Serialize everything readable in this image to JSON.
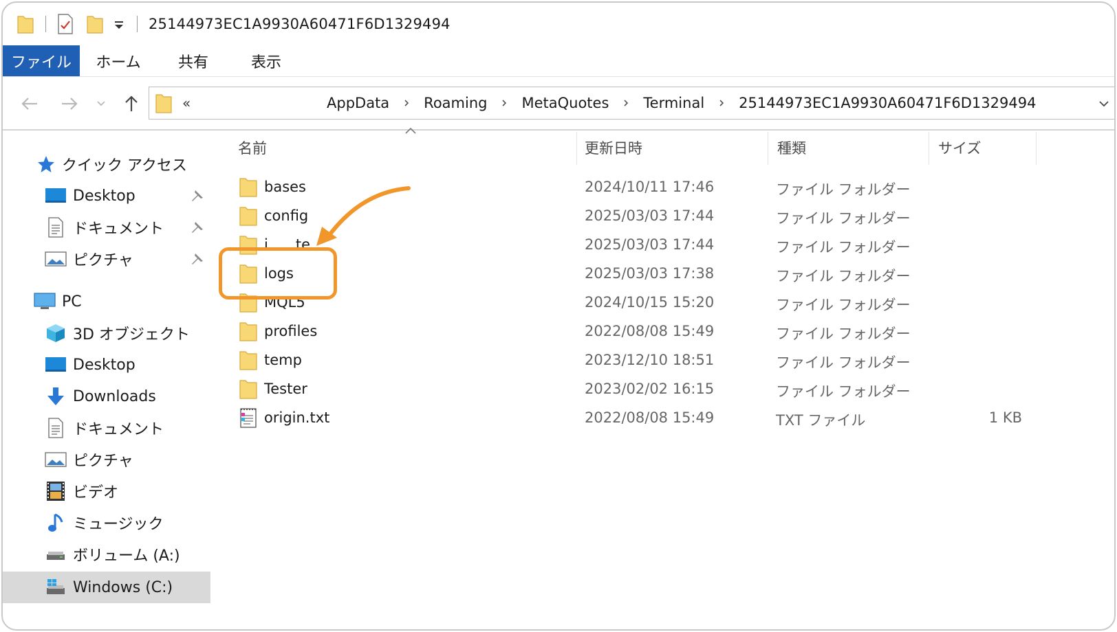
{
  "window": {
    "title": "25144973EC1A9930A60471F6D1329494"
  },
  "ribbon": {
    "tabs": [
      {
        "label": "ファイル"
      },
      {
        "label": "ホーム"
      },
      {
        "label": "共有"
      },
      {
        "label": "表示"
      }
    ]
  },
  "address": {
    "overflow": "«",
    "crumbs": [
      "AppData",
      "Roaming",
      "MetaQuotes",
      "Terminal",
      "25144973EC1A9930A60471F6D1329494"
    ]
  },
  "sidebar": {
    "quick_access": {
      "label": "クイック アクセス",
      "icon": "star-icon"
    },
    "quick_items": [
      {
        "label": "Desktop",
        "icon": "desktop-icon",
        "pinned": true
      },
      {
        "label": "ドキュメント",
        "icon": "document-icon",
        "pinned": true
      },
      {
        "label": "ピクチャ",
        "icon": "pictures-icon",
        "pinned": true
      }
    ],
    "pc": {
      "label": "PC",
      "icon": "computer-icon"
    },
    "pc_items": [
      {
        "label": "3D オブジェクト",
        "icon": "3d-objects-icon"
      },
      {
        "label": "Desktop",
        "icon": "desktop-icon"
      },
      {
        "label": "Downloads",
        "icon": "download-icon"
      },
      {
        "label": "ドキュメント",
        "icon": "document-icon"
      },
      {
        "label": "ピクチャ",
        "icon": "pictures-icon"
      },
      {
        "label": "ビデオ",
        "icon": "video-icon"
      },
      {
        "label": "ミュージック",
        "icon": "music-icon"
      },
      {
        "label": "ボリューム (A:)",
        "icon": "drive-icon"
      },
      {
        "label": "Windows (C:)",
        "icon": "windows-drive-icon",
        "selected": true
      }
    ]
  },
  "columns": {
    "name": "名前",
    "date": "更新日時",
    "type": "種類",
    "size": "サイズ"
  },
  "files": [
    {
      "name": "bases",
      "date": "2024/10/11 17:46",
      "type": "ファイル フォルダー",
      "size": "",
      "icon": "folder-icon"
    },
    {
      "name": "config",
      "date": "2025/03/03 17:44",
      "type": "ファイル フォルダー",
      "size": "",
      "icon": "folder-icon"
    },
    {
      "name": "i      te",
      "date": "2025/03/03 17:44",
      "type": "ファイル フォルダー",
      "size": "",
      "icon": "folder-icon"
    },
    {
      "name": "logs",
      "date": "2025/03/03 17:38",
      "type": "ファイル フォルダー",
      "size": "",
      "icon": "folder-icon",
      "highlighted": true
    },
    {
      "name": "MQL5",
      "date": "2024/10/15 15:20",
      "type": "ファイル フォルダー",
      "size": "",
      "icon": "folder-icon"
    },
    {
      "name": "profiles",
      "date": "2022/08/08 15:49",
      "type": "ファイル フォルダー",
      "size": "",
      "icon": "folder-icon"
    },
    {
      "name": "temp",
      "date": "2023/12/10 18:51",
      "type": "ファイル フォルダー",
      "size": "",
      "icon": "folder-icon"
    },
    {
      "name": "Tester",
      "date": "2023/02/02 16:15",
      "type": "ファイル フォルダー",
      "size": "",
      "icon": "folder-icon"
    },
    {
      "name": "origin.txt",
      "date": "2022/08/08 15:49",
      "type": "TXT ファイル",
      "size": "1 KB",
      "icon": "text-file-icon"
    }
  ],
  "colors": {
    "accent": "#1f5fb4",
    "highlight": "#f0962a",
    "folder": "#f8d775",
    "selected_bg": "#d9d9d9"
  }
}
